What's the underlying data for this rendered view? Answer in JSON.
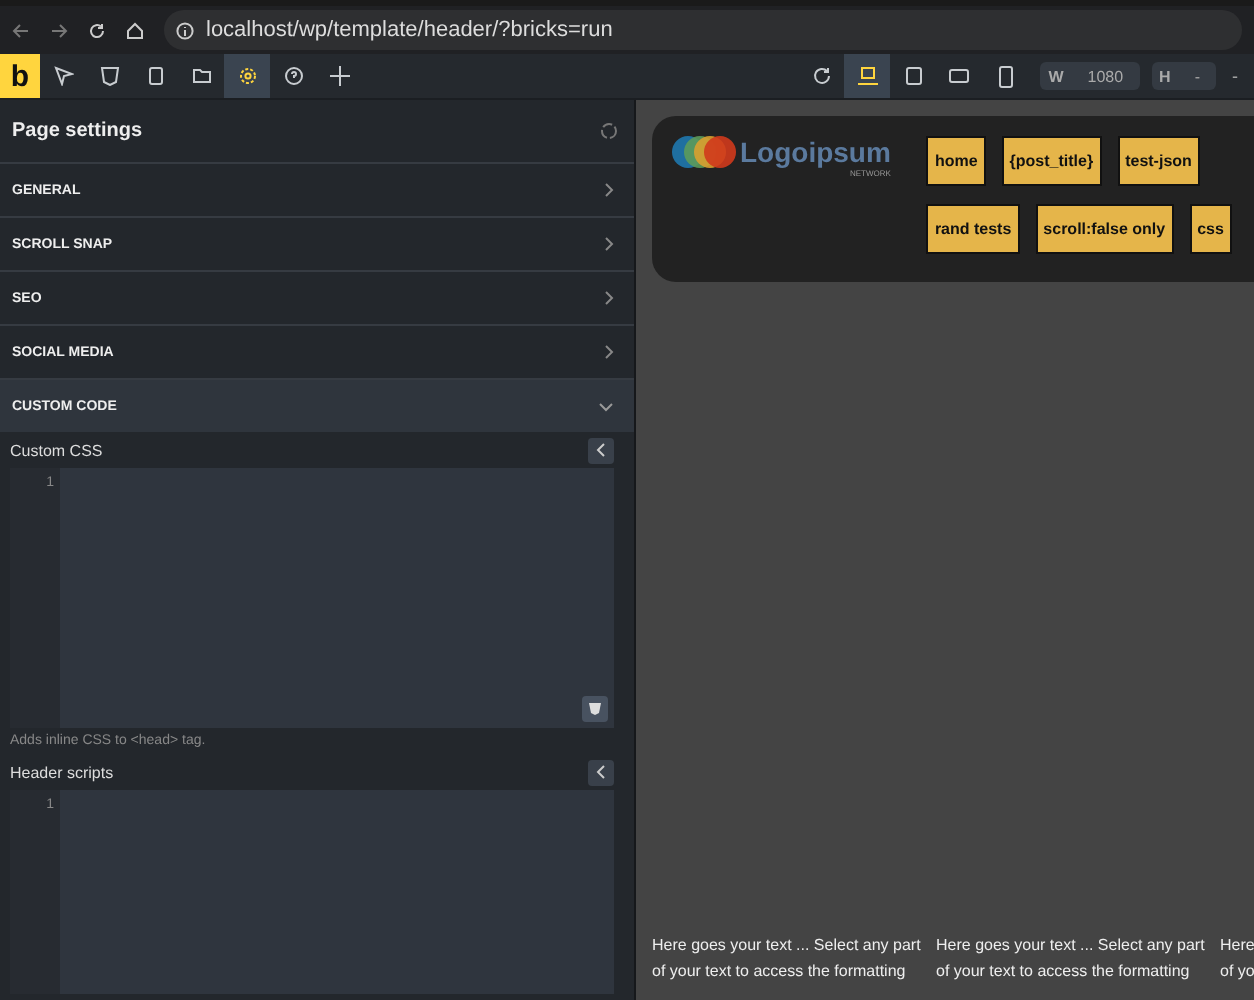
{
  "browser": {
    "url": "localhost/wp/template/header/?bricks=run"
  },
  "toolbar": {
    "logo": "b",
    "tools": [
      {
        "kind": "pointer",
        "selected": false
      },
      {
        "kind": "css",
        "selected": false
      },
      {
        "kind": "pages",
        "selected": false
      },
      {
        "kind": "folder",
        "selected": false
      },
      {
        "kind": "settings",
        "selected": true
      },
      {
        "kind": "help",
        "selected": false
      },
      {
        "kind": "add",
        "selected": false
      }
    ],
    "devices": [
      {
        "kind": "desktop",
        "selected": true
      },
      {
        "kind": "tablet",
        "selected": false
      },
      {
        "kind": "landscape",
        "selected": false
      },
      {
        "kind": "phone",
        "selected": false
      }
    ],
    "width": {
      "label": "W",
      "value": "1080"
    },
    "height": {
      "label": "H",
      "value": "-"
    },
    "extra": "-"
  },
  "panel": {
    "title": "Page settings",
    "sections": [
      {
        "label": "GENERAL",
        "expanded": false
      },
      {
        "label": "SCROLL SNAP",
        "expanded": false
      },
      {
        "label": "SEO",
        "expanded": false
      },
      {
        "label": "SOCIAL MEDIA",
        "expanded": false
      },
      {
        "label": "CUSTOM CODE",
        "expanded": true
      }
    ],
    "fields": [
      {
        "label": "Custom CSS",
        "line": "1",
        "hint": "Adds inline CSS to <head> tag.",
        "tall": true
      },
      {
        "label": "Header scripts",
        "line": "1",
        "tall": false
      }
    ]
  },
  "canvas": {
    "logo": {
      "name": "Logoipsum",
      "sub": "NETWORK"
    },
    "nav": [
      [
        "home",
        "{post_title}",
        "test-json"
      ],
      [
        "rand tests",
        "scroll:false only",
        "css"
      ]
    ],
    "columns": [
      [
        "Here goes your text ... Select any part",
        "of your text to access the formatting"
      ],
      [
        "Here goes your text ... Select any part",
        "of your text to access the formatting"
      ],
      [
        "Here",
        "of yo"
      ]
    ]
  }
}
